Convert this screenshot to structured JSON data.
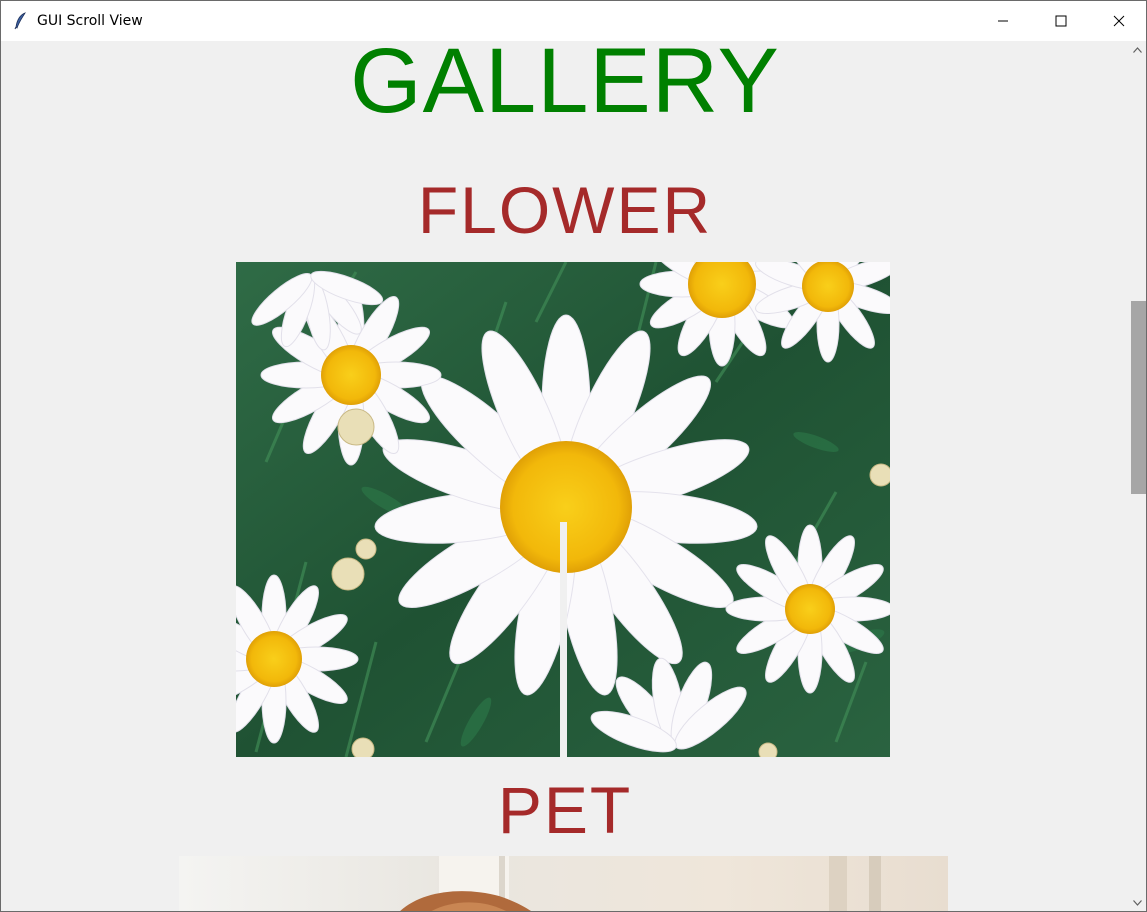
{
  "window": {
    "title": "GUI Scroll View",
    "icon": "feather-icon"
  },
  "content": {
    "heading": "GALLERY",
    "sections": [
      {
        "title": "FLOWER",
        "image": "daisy-flowers-image"
      },
      {
        "title": "PET",
        "image": "pet-photo-image"
      }
    ]
  },
  "colors": {
    "heading": "#008000",
    "section_title": "#a52a2a",
    "background": "#f0f0f0",
    "scroll_thumb": "#a6a6a6"
  }
}
